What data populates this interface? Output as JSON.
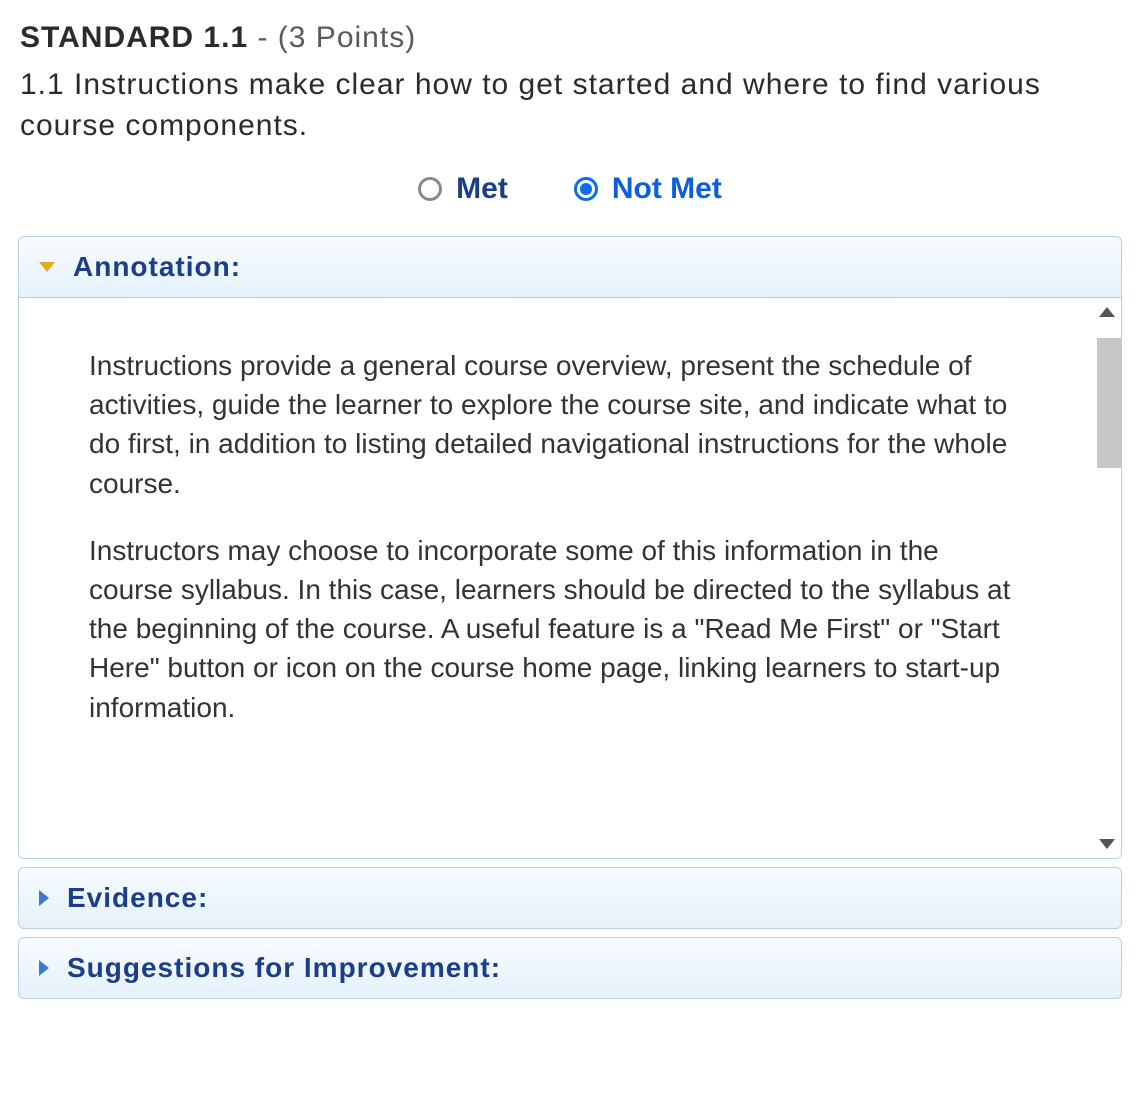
{
  "standard": {
    "label": "STANDARD 1.1",
    "points_text": " - (3 Points)",
    "description": "1.1 Instructions make clear how to get started and where to find various course components."
  },
  "radios": {
    "met": "Met",
    "not_met": "Not Met",
    "selected": "not_met"
  },
  "sections": {
    "annotation": {
      "title": "Annotation:",
      "para1": "Instructions provide a general course overview, present the schedule of activities, guide the learner to explore the course site, and indicate what to do first, in addition to listing detailed navigational instructions for the whole course.",
      "para2": "Instructors may choose to incorporate some of this information in the course syllabus. In this case, learners should be directed to the syllabus at the beginning of the course. A useful feature is a \"Read Me First\" or \"Start Here\" button or icon on the course home page, linking learners to start-up information."
    },
    "evidence": {
      "title": "Evidence:"
    },
    "suggestions": {
      "title": "Suggestions for Improvement:"
    }
  }
}
